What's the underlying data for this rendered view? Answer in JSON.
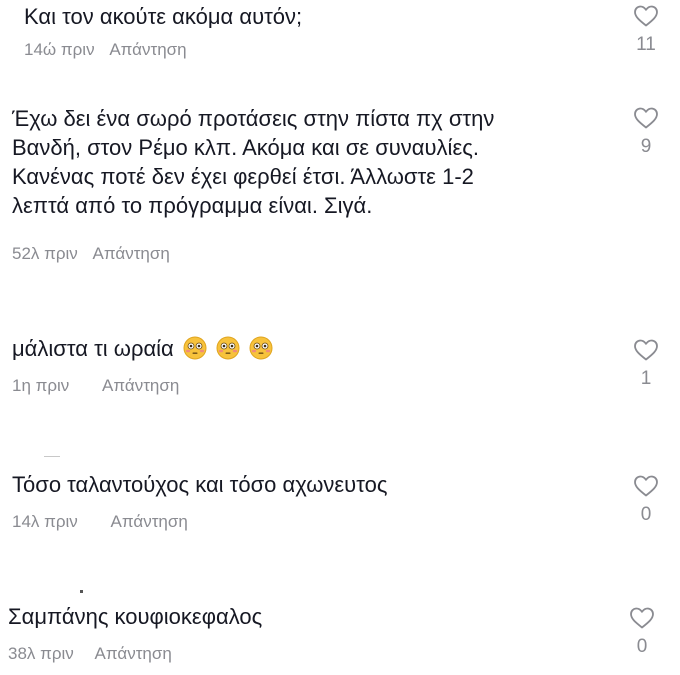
{
  "comments": [
    {
      "text": "Και τον ακούτε ακόμα αυτόν;",
      "time": "14ώ πριν",
      "reply": "Απάντηση",
      "likes": "11"
    },
    {
      "text_lines": [
        "Έχω δει ένα σωρό προτάσεις στην πίστα πχ στην",
        "Βανδή, στον Ρέμο κλπ. Ακόμα και σε συναυλίες.",
        "Κανένας ποτέ δεν έχει φερθεί έτσι. Άλλωστε 1-2",
        "λεπτά από το πρόγραμμα είναι. Σιγά."
      ],
      "time": "52λ πριν",
      "reply": "Απάντηση",
      "likes": "9"
    },
    {
      "text": "μάλιστα τι ωραία",
      "emojis": [
        "flushed-face-icon",
        "flushed-face-icon",
        "flushed-face-icon"
      ],
      "time": "1η πριν",
      "reply": "Απάντηση",
      "likes": "1"
    },
    {
      "text": "Τόσο ταλαντούχος και τόσο αχωνευτος",
      "time": "14λ πριν",
      "reply": "Απάντηση",
      "likes": "0"
    },
    {
      "text": "Σαμπάνης κουφιοκεφαλος",
      "time": "38λ πριν",
      "reply": "Απάντηση",
      "likes": "0"
    }
  ],
  "icons": {
    "like": "heart-outline-icon"
  },
  "colors": {
    "text": "#161823",
    "meta": "#8a8b91",
    "emoji_face": "#f7c23c"
  }
}
